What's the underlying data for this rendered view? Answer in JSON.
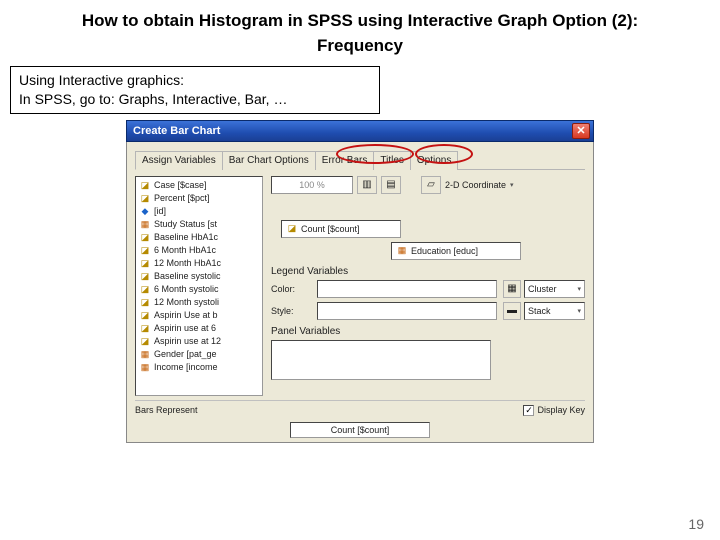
{
  "slide": {
    "title": "How to obtain Histogram in SPSS using Interactive Graph Option (2):",
    "subtitle": "Frequency",
    "instruction_l1": "Using Interactive graphics:",
    "instruction_l2": "In SPSS, go to: Graphs, Interactive, Bar, …",
    "page_number": "19"
  },
  "dialog": {
    "title": "Create Bar Chart",
    "tabs": [
      "Assign Variables",
      "Bar Chart Options",
      "Error Bars",
      "Titles",
      "Options"
    ],
    "active_tab": 0,
    "var_list": [
      {
        "icon": "scale",
        "label": "Case [$case]"
      },
      {
        "icon": "scale",
        "label": "Percent [$pct]"
      },
      {
        "icon": "nom",
        "label": "[id]"
      },
      {
        "icon": "set",
        "label": "Study Status [st"
      },
      {
        "icon": "scale",
        "label": "Baseline HbA1c"
      },
      {
        "icon": "scale",
        "label": "6 Month HbA1c"
      },
      {
        "icon": "scale",
        "label": "12 Month HbA1c"
      },
      {
        "icon": "scale",
        "label": "Baseline systolic"
      },
      {
        "icon": "scale",
        "label": "6 Month systolic"
      },
      {
        "icon": "scale",
        "label": "12 Month systoli"
      },
      {
        "icon": "scale",
        "label": "Aspirin Use at b"
      },
      {
        "icon": "scale",
        "label": "Aspirin use at 6"
      },
      {
        "icon": "scale",
        "label": "Aspirin use at 12"
      },
      {
        "icon": "set",
        "label": "Gender [pat_ge"
      },
      {
        "icon": "set",
        "label": "Income [income"
      }
    ],
    "toolbar": {
      "pct_box": "100 %",
      "coord_label": "2-D Coordinate"
    },
    "axis_y": {
      "icon": "scale",
      "label": "Count [$count]"
    },
    "axis_x": {
      "icon": "set",
      "label": "Education [educ]"
    },
    "section_legend": "Legend Variables",
    "legend_color": "Color:",
    "legend_style": "Style:",
    "cluster_label": "Cluster",
    "stack_label": "Stack",
    "section_panel": "Panel Variables",
    "bars_represent": "Bars Represent",
    "display_key": "Display Key",
    "footer_field": "Count [$count]"
  }
}
